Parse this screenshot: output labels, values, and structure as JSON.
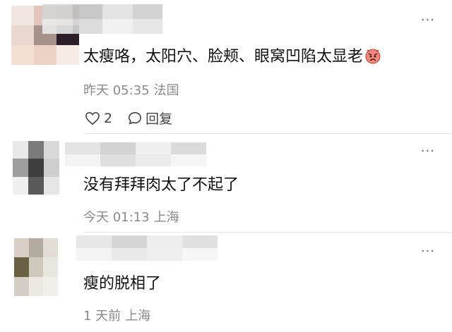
{
  "comments": [
    {
      "text": "太瘦咯，太阳穴、脸颊、眼窝凹陷太显老",
      "emoji": "angry-face-emoji",
      "time": "昨天 05:35",
      "location": "法国",
      "likes": "2",
      "reply_label": "回复",
      "more": "···",
      "avatar_colors": [
        "#f1e7e2",
        "#e0c6bd",
        "#b9a4a0",
        "#e9d8d0",
        "#a8928c",
        "#2a1f28",
        "#f3dfd4",
        "#ecd2c5",
        "#f6ece6"
      ],
      "name_colors": [
        "#d6d6d6",
        "#c2c2c2",
        "#e2e2e2",
        "#cfcfcf",
        "#ebebeb",
        "#d9d9d9",
        "#f0f0f0",
        "#e5e5e5"
      ]
    },
    {
      "text": "没有拜拜肉太了不起了",
      "time": "今天 01:13",
      "location": "上海",
      "more": "···",
      "avatar_colors": [
        "#e8e8e8",
        "#7a7a7a",
        "#d9d9d9",
        "#9e9e9e",
        "#3e3e3e",
        "#cfcfcf",
        "#f0f0f0",
        "#5a5a5a",
        "#e6e6e6"
      ],
      "name_colors": [
        "#e0e0e0",
        "#cccccc",
        "#ededed",
        "#d5d5d5",
        "#f2f2f2",
        "#dadada",
        "#e8e8e8",
        "#f4f4f4"
      ]
    },
    {
      "text": "瘦的脱相了",
      "time": "1 天前",
      "location": "上海",
      "more": "···",
      "avatar_colors": [
        "#d8d0c6",
        "#b4aba0",
        "#e2dcd4",
        "#6a6044",
        "#cfc8bd",
        "#e9e5df",
        "#d4cec6",
        "#ece8e2",
        "#f2efea"
      ],
      "name_colors": [
        "#e3e3e3",
        "#d0d0d0",
        "#ececec",
        "#dcdcdc",
        "#f3f3f3",
        "#e6e6e6",
        "#eeeeee",
        "#f6f6f6"
      ]
    }
  ]
}
